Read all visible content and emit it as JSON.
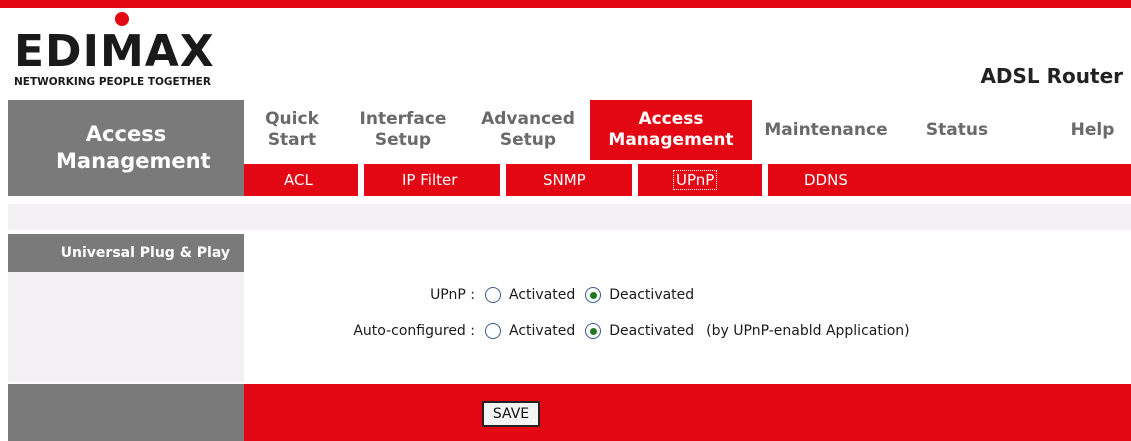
{
  "brand": {
    "logo_text": "EDIMAX",
    "tagline": "NETWORKING PEOPLE TOGETHER",
    "product": "ADSL Router",
    "accent_color": "#e30613"
  },
  "left_title": "Access Management",
  "nav": {
    "items": [
      {
        "label": "Quick Start"
      },
      {
        "label": "Interface Setup"
      },
      {
        "label": "Advanced Setup"
      },
      {
        "label": "Access Management",
        "active": true
      },
      {
        "label": "Maintenance"
      },
      {
        "label": "Status"
      },
      {
        "label": "Help"
      }
    ]
  },
  "subnav": {
    "items": [
      {
        "label": "ACL"
      },
      {
        "label": "IP Filter"
      },
      {
        "label": "SNMP"
      },
      {
        "label": "UPnP",
        "current": true
      },
      {
        "label": "DDNS"
      }
    ]
  },
  "section": {
    "title": "Universal Plug & Play"
  },
  "form": {
    "upnp": {
      "label": "UPnP :",
      "options": [
        "Activated",
        "Deactivated"
      ],
      "selected": "Deactivated"
    },
    "auto": {
      "label": "Auto-configured :",
      "options": [
        "Activated",
        "Deactivated"
      ],
      "selected": "Deactivated",
      "note": "(by UPnP-enabld Application)"
    }
  },
  "footer": {
    "save_label": "SAVE"
  }
}
